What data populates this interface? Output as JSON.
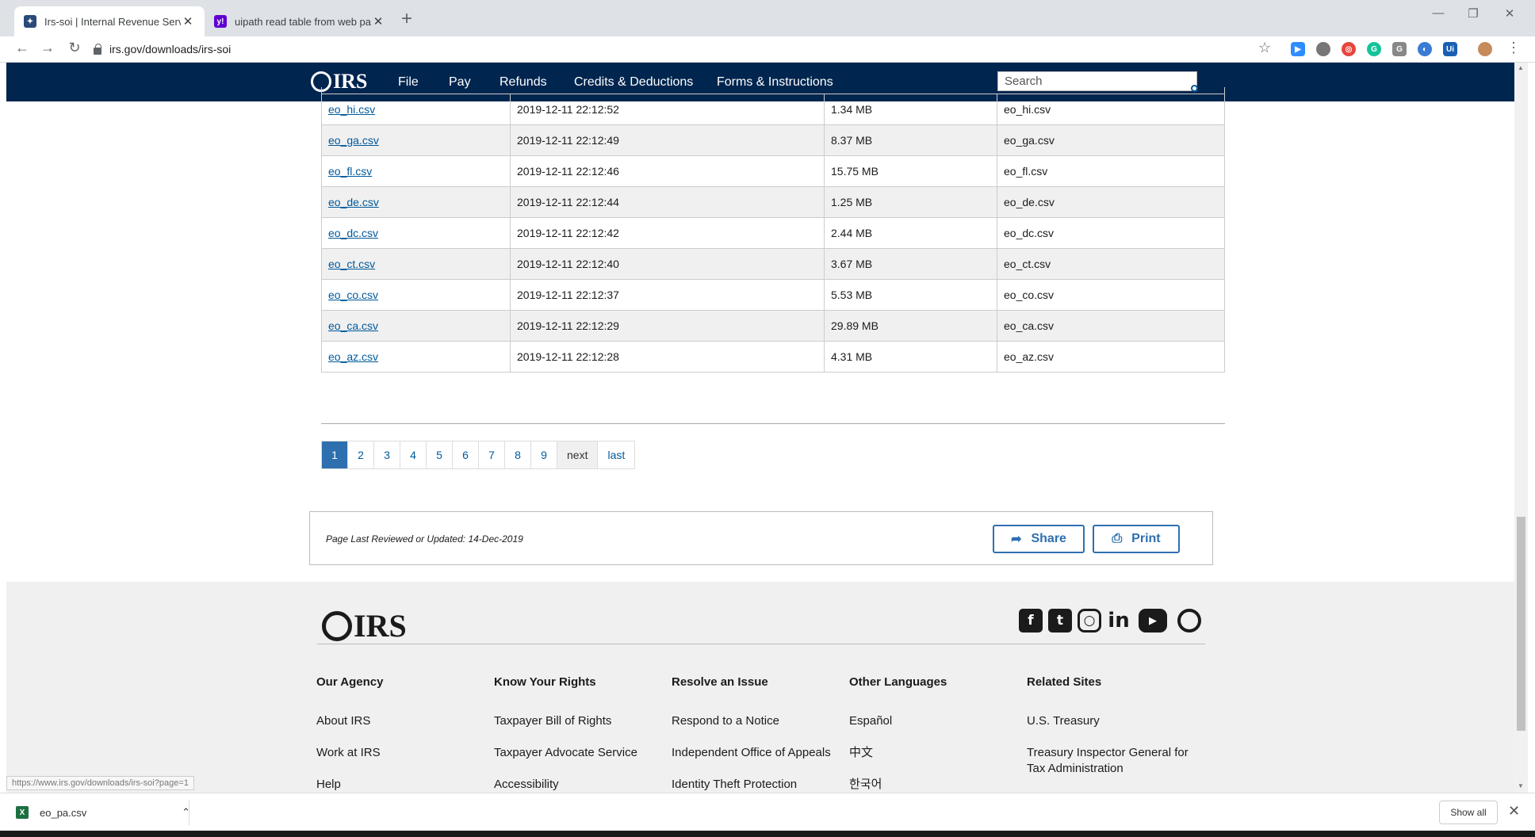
{
  "browser": {
    "tabs": [
      {
        "title": "Irs-soi | Internal Revenue Service",
        "active": true
      },
      {
        "title": "uipath read table from web page",
        "active": false
      }
    ],
    "new_tab": "+",
    "url": "irs.gov/downloads/irs-soi",
    "status_url": "https://www.irs.gov/downloads/irs-soi?page=1"
  },
  "irs": {
    "logo_text": "IRS",
    "nav": [
      "File",
      "Pay",
      "Refunds",
      "Credits & Deductions",
      "Forms & Instructions"
    ],
    "search_placeholder": "Search"
  },
  "table": {
    "rows": [
      {
        "link": "eo_hi.csv",
        "date": "2019-12-11 22:12:52",
        "size": "1.34 MB",
        "name": "eo_hi.csv"
      },
      {
        "link": "eo_ga.csv",
        "date": "2019-12-11 22:12:49",
        "size": "8.37 MB",
        "name": "eo_ga.csv"
      },
      {
        "link": "eo_fl.csv",
        "date": "2019-12-11 22:12:46",
        "size": "15.75 MB",
        "name": "eo_fl.csv"
      },
      {
        "link": "eo_de.csv",
        "date": "2019-12-11 22:12:44",
        "size": "1.25 MB",
        "name": "eo_de.csv"
      },
      {
        "link": "eo_dc.csv",
        "date": "2019-12-11 22:12:42",
        "size": "2.44 MB",
        "name": "eo_dc.csv"
      },
      {
        "link": "eo_ct.csv",
        "date": "2019-12-11 22:12:40",
        "size": "3.67 MB",
        "name": "eo_ct.csv"
      },
      {
        "link": "eo_co.csv",
        "date": "2019-12-11 22:12:37",
        "size": "5.53 MB",
        "name": "eo_co.csv"
      },
      {
        "link": "eo_ca.csv",
        "date": "2019-12-11 22:12:29",
        "size": "29.89 MB",
        "name": "eo_ca.csv"
      },
      {
        "link": "eo_az.csv",
        "date": "2019-12-11 22:12:28",
        "size": "4.31 MB",
        "name": "eo_az.csv"
      }
    ]
  },
  "pager": {
    "pages": [
      "1",
      "2",
      "3",
      "4",
      "5",
      "6",
      "7",
      "8",
      "9"
    ],
    "next": "next",
    "last": "last",
    "current": "1"
  },
  "review": {
    "text": "Page Last Reviewed or Updated: 14-Dec-2019",
    "share": "Share",
    "print": "Print"
  },
  "footer": {
    "logo_text": "IRS",
    "columns": [
      {
        "heading": "Our Agency",
        "links": [
          "About IRS",
          "Work at IRS",
          "Help"
        ]
      },
      {
        "heading": "Know Your Rights",
        "links": [
          "Taxpayer Bill of Rights",
          "Taxpayer Advocate Service",
          "Accessibility"
        ]
      },
      {
        "heading": "Resolve an Issue",
        "links": [
          "Respond to a Notice",
          "Independent Office of Appeals",
          "Identity Theft Protection"
        ]
      },
      {
        "heading": "Other Languages",
        "links": [
          "Español",
          "中文",
          "한국어"
        ]
      },
      {
        "heading": "Related Sites",
        "links": [
          "U.S. Treasury",
          "Treasury Inspector General for Tax Administration"
        ]
      }
    ],
    "social": [
      "facebook-icon",
      "twitter-icon",
      "instagram-icon",
      "linkedin-icon",
      "youtube-icon",
      "irs-eagle-icon"
    ]
  },
  "downloads": {
    "file": "eo_pa.csv",
    "show_all": "Show all"
  },
  "colors": {
    "irs_navy": "#00254f",
    "link_blue": "#00599c",
    "button_blue": "#2e6faf",
    "footer_gray": "#f0f0f0"
  }
}
